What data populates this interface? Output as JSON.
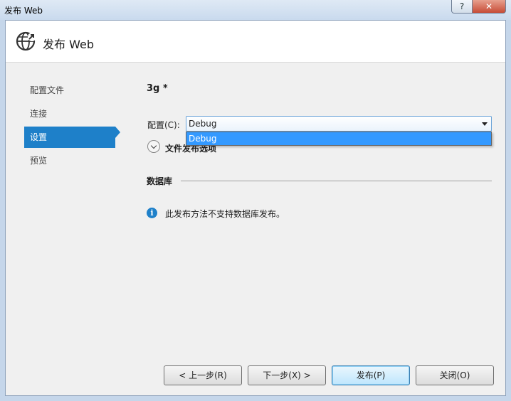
{
  "window": {
    "title": "发布 Web",
    "help_label": "?",
    "close_label": "✕"
  },
  "header": {
    "title": "发布 Web",
    "icon": "globe-arrow-icon"
  },
  "nav": {
    "items": [
      {
        "label": "配置文件"
      },
      {
        "label": "连接"
      },
      {
        "label": "设置"
      },
      {
        "label": "预览"
      }
    ],
    "active": "设置"
  },
  "main": {
    "profile_name": "3g *",
    "config": {
      "label": "配置(C):",
      "value": "Debug",
      "options": [
        "Debug"
      ]
    },
    "file_publish_options": {
      "label": "文件发布选项"
    },
    "database": {
      "heading": "数据库",
      "info_icon": "i",
      "info_text": "此发布方法不支持数据库发布。"
    }
  },
  "footer": {
    "prev_label": "< 上一步(R)",
    "next_label": "下一步(X) >",
    "publish_label": "发布(P)",
    "close_label": "关闭(O)"
  },
  "colors": {
    "accent": "#1e80c9",
    "selection": "#3399ff"
  }
}
